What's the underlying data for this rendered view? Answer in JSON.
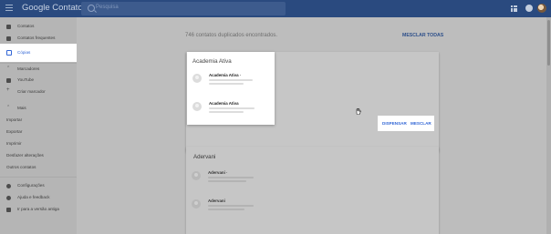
{
  "header": {
    "app_title": "Google Contatos",
    "search_placeholder": "Pesquisa"
  },
  "sidebar": {
    "items": [
      {
        "label": "Contatos",
        "icon": "person-icon"
      },
      {
        "label": "Contatos frequentes",
        "icon": "history-icon"
      },
      {
        "label": "Cópias",
        "icon": "copy-icon",
        "active": true
      },
      {
        "label": "Marcadores",
        "icon": "chevron-up-icon"
      },
      {
        "label": "YouTube",
        "icon": "label-icon"
      },
      {
        "label": "Criar marcador",
        "icon": "plus-icon"
      },
      {
        "label": "Mais",
        "icon": "chevron-up-icon"
      },
      {
        "label": "Importar"
      },
      {
        "label": "Exportar"
      },
      {
        "label": "Imprimir"
      },
      {
        "label": "Desfazer alterações"
      },
      {
        "label": "Outros contatos"
      },
      {
        "label": "Configurações",
        "icon": "gear-icon"
      },
      {
        "label": "Ajuda e feedback",
        "icon": "help-icon"
      },
      {
        "label": "Ir para a versão antiga",
        "icon": "grid-icon"
      }
    ]
  },
  "main": {
    "summary": "746 contatos duplicados encontrados.",
    "merge_all": "MESCLAR TODAS",
    "groups": [
      {
        "title": "Academia Ativa",
        "contacts": [
          {
            "name": "Academia Ativa ·"
          },
          {
            "name": "Academia Ativa"
          }
        ]
      },
      {
        "title": "Adervani",
        "contacts": [
          {
            "name": "Adervani ·"
          },
          {
            "name": "Adervani"
          }
        ]
      }
    ],
    "dismiss": "DISPENSAR",
    "merge": "MESCLAR"
  },
  "colors": {
    "header": "#2a4a7f",
    "accent": "#3367d6"
  }
}
